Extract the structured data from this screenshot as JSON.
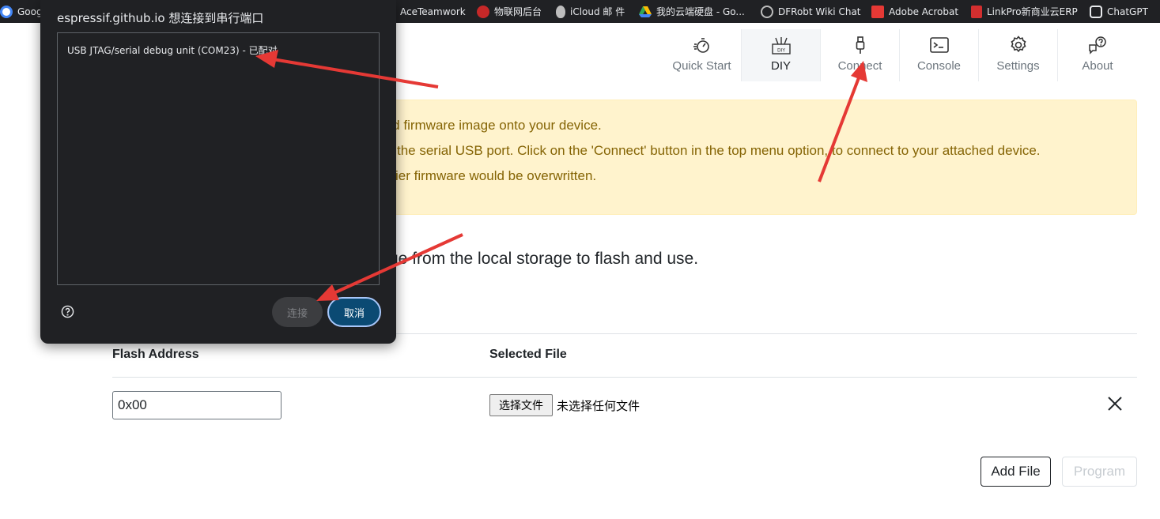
{
  "bookmarks": [
    {
      "label": "Google",
      "icon": "google-icon",
      "color": "#4285f4"
    },
    {
      "label": "AceTeamwork",
      "icon": "aceteamwork-icon",
      "color": "#e8eaed"
    },
    {
      "label": "物联网后台",
      "icon": "iot-icon",
      "color": "#c62828"
    },
    {
      "label": "iCloud 邮 件",
      "icon": "apple-icon",
      "color": "#bdbdbd"
    },
    {
      "label": "我的云端硬盘 - Go...",
      "icon": "google-drive-icon",
      "color": "#fbbc04"
    },
    {
      "label": "DFRobt Wiki Chat",
      "icon": "globe-icon",
      "color": "#bdbdbd"
    },
    {
      "label": "Adobe Acrobat",
      "icon": "acrobat-icon",
      "color": "#e53935"
    },
    {
      "label": "LinkPro新商业云ERP",
      "icon": "linkpro-icon",
      "color": "#d32f2f"
    },
    {
      "label": "ChatGPT",
      "icon": "chatgpt-icon",
      "color": "#e8eaed"
    }
  ],
  "nav": {
    "items": [
      {
        "label": "Quick Start",
        "icon": "quick-start-icon"
      },
      {
        "label": "DIY",
        "icon": "diy-icon"
      },
      {
        "label": "Connect",
        "icon": "usb-plug-icon"
      },
      {
        "label": "Console",
        "icon": "console-icon"
      },
      {
        "label": "Settings",
        "icon": "gear-icon"
      },
      {
        "label": "About",
        "icon": "about-icon"
      }
    ],
    "active": "DIY"
  },
  "alert": {
    "line1": "ted firmware image onto your device.",
    "line2": "the serial USB port. Click on the 'Connect' button in the top menu option, to connect to your attached device.",
    "line3": "ier firmware would be overwritten."
  },
  "main": {
    "heading": "ge from the local storage to flash and use."
  },
  "table": {
    "headers": [
      "Flash Address",
      "Selected File"
    ],
    "rows": [
      {
        "address": "0x00",
        "file_button": "选择文件",
        "file_status": "未选择任何文件"
      }
    ]
  },
  "actions": {
    "add_file": "Add File",
    "program": "Program"
  },
  "dialog": {
    "title": "espressif.github.io 想连接到串行端口",
    "ports": [
      "USB JTAG/serial debug unit (COM23) - 已配对"
    ],
    "connect_label": "连接",
    "cancel_label": "取消",
    "help_icon": "help-circle-icon"
  },
  "annotation_color": "#e53935"
}
